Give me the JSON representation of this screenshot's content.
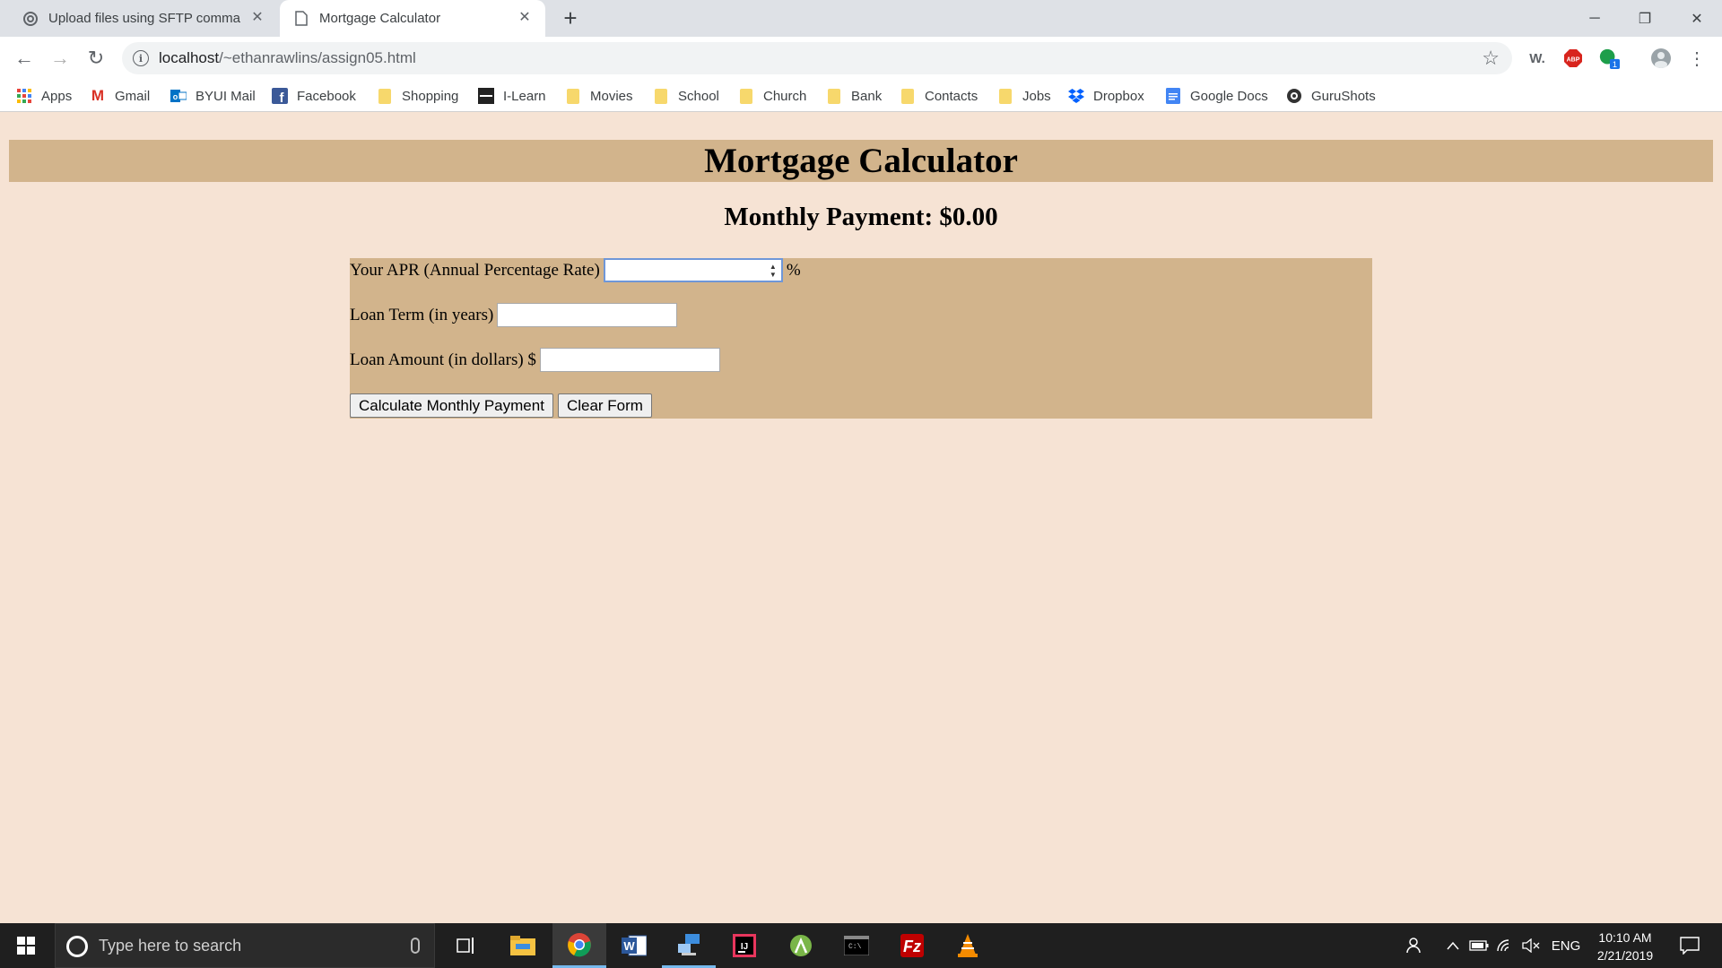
{
  "browser": {
    "tabs": [
      {
        "title": "Upload files using SFTP comman",
        "icon": "chrome-loading-icon"
      },
      {
        "title": "Mortgage Calculator",
        "icon": "page-icon"
      }
    ],
    "url_host": "localhost",
    "url_path": "/~ethanrawlins/assign05.html",
    "bookmarks": [
      {
        "label": "Apps",
        "icon": "apps-grid-icon"
      },
      {
        "label": "Gmail",
        "icon": "gmail-icon"
      },
      {
        "label": "BYUI Mail",
        "icon": "outlook-icon"
      },
      {
        "label": "Facebook",
        "icon": "facebook-icon"
      },
      {
        "label": "Shopping",
        "icon": "folder-icon"
      },
      {
        "label": "I-Learn",
        "icon": "byu-icon"
      },
      {
        "label": "Movies",
        "icon": "folder-icon"
      },
      {
        "label": "School",
        "icon": "folder-icon"
      },
      {
        "label": "Church",
        "icon": "folder-icon"
      },
      {
        "label": "Bank",
        "icon": "folder-icon"
      },
      {
        "label": "Contacts",
        "icon": "folder-icon"
      },
      {
        "label": "Jobs",
        "icon": "folder-icon"
      },
      {
        "label": "Dropbox",
        "icon": "dropbox-icon"
      },
      {
        "label": "Google Docs",
        "icon": "google-docs-icon"
      },
      {
        "label": "GuruShots",
        "icon": "gurushots-icon"
      }
    ],
    "extensions": {
      "w_label": "W.",
      "abp_label": "ABP",
      "badge_count": "1"
    }
  },
  "page": {
    "title": "Mortgage Calculator",
    "payment_text": "Monthly Payment: $0.00",
    "apr_label": "Your APR (Annual Percentage Rate)",
    "apr_value": "",
    "apr_suffix": "%",
    "term_label": "Loan Term (in years)",
    "term_value": "",
    "amount_label": "Loan Amount (in dollars) $",
    "amount_value": "",
    "calc_button": "Calculate Monthly Payment",
    "clear_button": "Clear Form",
    "colors": {
      "background": "#f6e3d4",
      "accent": "#d2b48c"
    }
  },
  "taskbar": {
    "search_placeholder": "Type here to search",
    "language": "ENG",
    "time": "10:10 AM",
    "date": "2/21/2019"
  }
}
